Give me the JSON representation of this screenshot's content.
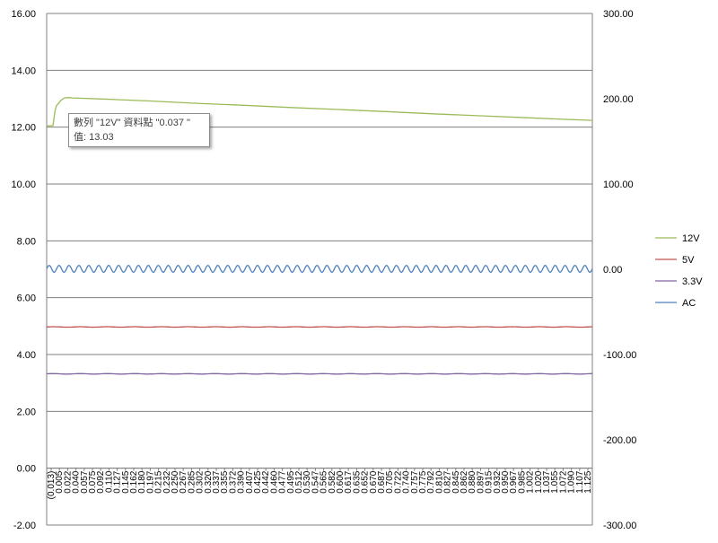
{
  "chart_data": {
    "type": "line",
    "y_left": {
      "range": [
        -2,
        16
      ],
      "ticks": [
        "-2.00",
        "0.00",
        "2.00",
        "4.00",
        "6.00",
        "8.00",
        "10.00",
        "12.00",
        "14.00",
        "16.00"
      ]
    },
    "y_right": {
      "range": [
        -300,
        300
      ],
      "ticks": [
        "-300.00",
        "-200.00",
        "-100.00",
        "0.00",
        "100.00",
        "200.00",
        "300.00"
      ]
    },
    "x_range": [
      -0.0175,
      1.1375
    ],
    "x_tick_labels": [
      "(0.013)",
      "0.005",
      "0.022",
      "0.040",
      "0.057",
      "0.075",
      "0.092",
      "0.110",
      "0.127",
      "0.145",
      "0.162",
      "0.180",
      "0.197",
      "0.215",
      "0.232",
      "0.250",
      "0.267",
      "0.285",
      "0.302",
      "0.320",
      "0.337",
      "0.355",
      "0.372",
      "0.390",
      "0.407",
      "0.425",
      "0.442",
      "0.460",
      "0.477",
      "0.495",
      "0.512",
      "0.530",
      "0.547",
      "0.565",
      "0.582",
      "0.600",
      "0.617",
      "0.635",
      "0.652",
      "0.670",
      "0.687",
      "0.705",
      "0.722",
      "0.740",
      "0.757",
      "0.775",
      "0.792",
      "0.810",
      "0.827",
      "0.845",
      "0.862",
      "0.880",
      "0.897",
      "0.915",
      "0.932",
      "0.950",
      "0.967",
      "0.985",
      "1.002",
      "1.020",
      "1.037",
      "1.055",
      "1.072",
      "1.090",
      "1.107",
      "1.125"
    ],
    "grid": "horizontal",
    "legend_position": "right",
    "series": [
      {
        "name": "12V",
        "axis": "left",
        "color": "#9bbb59",
        "points": [
          [
            -0.0175,
            12.05
          ],
          [
            -0.008,
            12.05
          ],
          [
            -0.004,
            12.06
          ],
          [
            0.0,
            12.55
          ],
          [
            0.003,
            12.75
          ],
          [
            0.008,
            12.85
          ],
          [
            0.013,
            12.95
          ],
          [
            0.02,
            13.03
          ],
          [
            0.03,
            13.04
          ],
          [
            0.037,
            13.03
          ],
          [
            0.1,
            12.99
          ],
          [
            0.2,
            12.92
          ],
          [
            0.3,
            12.84
          ],
          [
            0.4,
            12.77
          ],
          [
            0.5,
            12.69
          ],
          [
            0.6,
            12.62
          ],
          [
            0.7,
            12.55
          ],
          [
            0.8,
            12.47
          ],
          [
            0.9,
            12.4
          ],
          [
            1.0,
            12.33
          ],
          [
            1.1,
            12.26
          ],
          [
            1.1375,
            12.24
          ]
        ]
      },
      {
        "name": "5V",
        "axis": "left",
        "color": "#c0504d",
        "value": 4.97
      },
      {
        "name": "3.3V",
        "axis": "left",
        "color": "#8064a2",
        "value": 3.32
      },
      {
        "name": "AC",
        "axis": "right",
        "color": "#4f81bd",
        "offset": 0.5,
        "amplitude": 4,
        "cycles": 55
      }
    ],
    "tooltip": {
      "line1": "數列 \"12V\" 資料點 \"0.037 \"",
      "line2": "值: 13.03"
    }
  }
}
